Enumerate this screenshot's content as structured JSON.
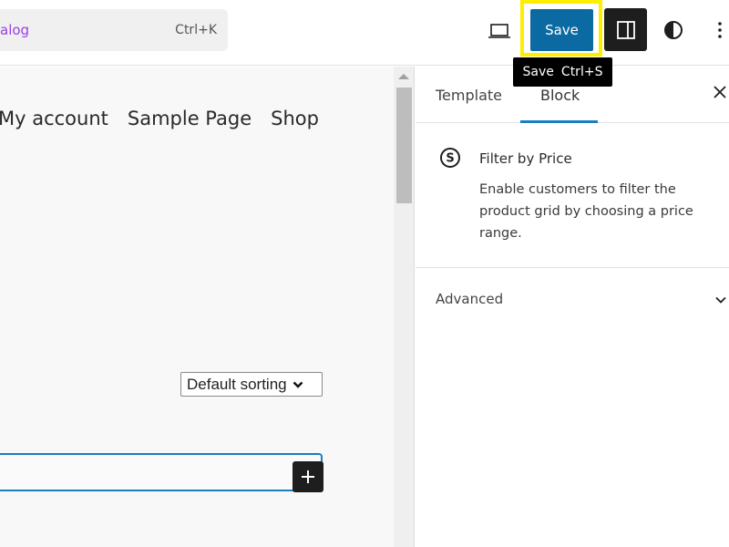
{
  "header": {
    "command_bar": {
      "text": "alog",
      "shortcut": "Ctrl+K"
    },
    "preview_icon": "laptop-icon",
    "save_label": "Save",
    "save_tooltip": {
      "label": "Save",
      "shortcut": "Ctrl+S"
    },
    "settings_icon": "sidebar-panel-icon",
    "styles_icon": "half-circle-contrast-icon",
    "options_icon": "vertical-ellipsis-icon",
    "colors": {
      "save_bg": "#0b6aa1",
      "highlight": "#ffee00",
      "command_text": "#9b3fe0"
    }
  },
  "canvas": {
    "nav_items": [
      "My account",
      "Sample Page",
      "Shop"
    ],
    "sort_select": {
      "selected": "Default sorting"
    },
    "add_block_icon": "plus-icon",
    "block_border_color": "#1a7ec2"
  },
  "sidebar": {
    "tabs": [
      {
        "label": "Template",
        "active": false
      },
      {
        "label": "Block",
        "active": true
      }
    ],
    "close_icon": "close-icon",
    "block": {
      "icon": "dollar-circle-icon",
      "title": "Filter by Price",
      "description": "Enable customers to filter the product grid by choosing a price range."
    },
    "panels": [
      {
        "label": "Advanced",
        "expanded": false
      }
    ]
  }
}
